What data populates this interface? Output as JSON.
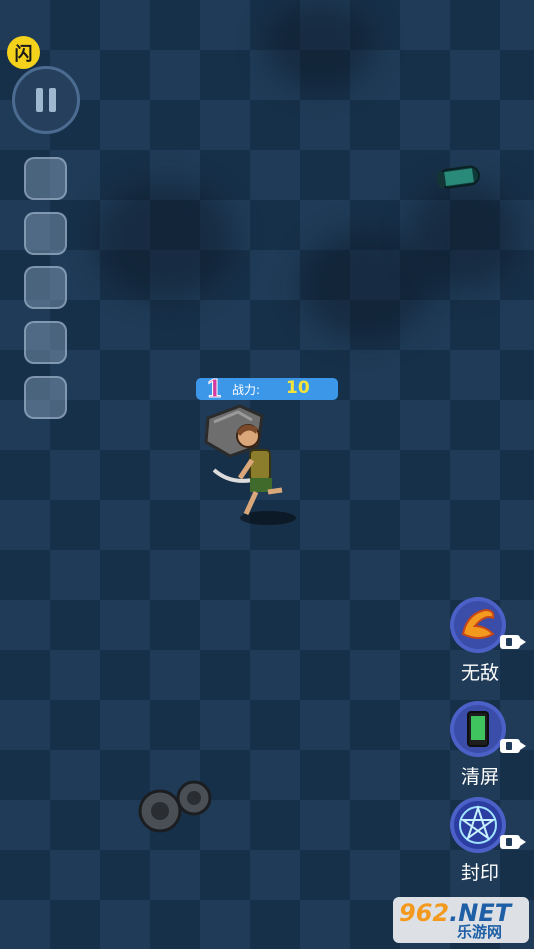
{
  "badge": {
    "text": "闪"
  },
  "hud": {
    "level": "1",
    "power_label": "战力:",
    "power_value": "10"
  },
  "slots": [
    {},
    {},
    {},
    {},
    {}
  ],
  "side_buttons": [
    {
      "label": "无敌",
      "icon": "invincible-icon"
    },
    {
      "label": "清屏",
      "icon": "phone-icon"
    },
    {
      "label": "封印",
      "icon": "pentagram-icon"
    }
  ],
  "watermark": {
    "brand": "962",
    "domain": ".NET",
    "text": "乐游网"
  },
  "colors": {
    "board_light": "#1f3b57",
    "board_dark": "#173049",
    "hud_bar": "#3c97e8",
    "power_value": "#f3e33a",
    "button_ring": "#4b61c8"
  }
}
